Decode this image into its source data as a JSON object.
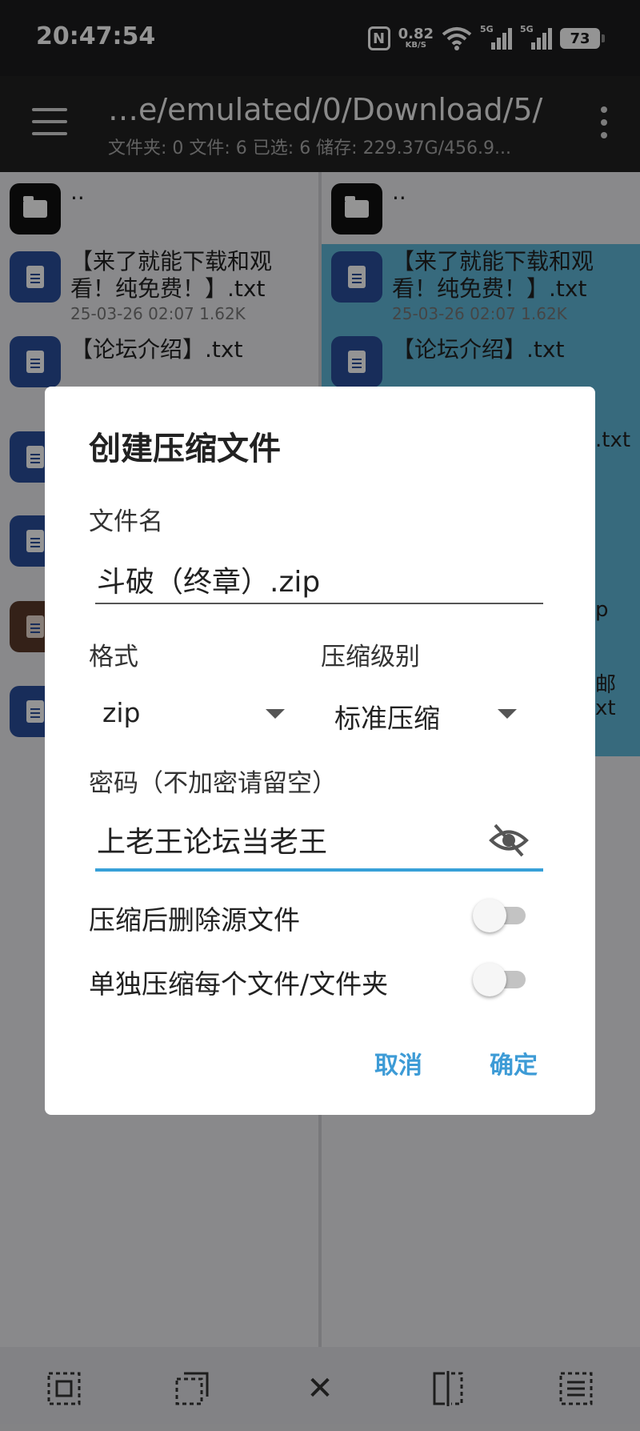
{
  "status_bar": {
    "time": "20:47:54",
    "nfc": "N",
    "net_speed": "0.82",
    "net_unit": "KB/S",
    "sim1_label": "5G",
    "sim2_label": "5G",
    "battery": "73"
  },
  "toolbar": {
    "path": "…e/emulated/0/Download/5/",
    "summary": "文件夹: 0  文件: 6  已选: 6  储存: 229.37G/456.9..."
  },
  "left_pane": {
    "parent": "..",
    "file1_name": "【来了就能下载和观看！纯免费！】.txt",
    "file1_meta": "25-03-26 02:07  1.62K",
    "file2_name": "【论坛介绍】.txt"
  },
  "right_pane": {
    "parent": "..",
    "file1_name": "【来了就能下载和观看！纯免费！】.txt",
    "file1_meta": "25-03-26 02:07  1.62K",
    "file2_name": "【论坛介绍】.txt",
    "frag_txt": ".txt",
    "frag_p": "p",
    "frag_you": "邮",
    "frag_xt": "xt"
  },
  "dialog": {
    "title": "创建压缩文件",
    "filename_label": "文件名",
    "filename_value": "斗破（终章）.zip",
    "format_label": "格式",
    "format_value": "zip",
    "level_label": "压缩级别",
    "level_value": "标准压缩",
    "password_label": "密码（不加密请留空）",
    "password_value": "上老王论坛当老王",
    "delete_source_label": "压缩后删除源文件",
    "separate_label": "单独压缩每个文件/文件夹",
    "cancel": "取消",
    "ok": "确定"
  },
  "bottom_bar": {
    "close_glyph": "✕"
  }
}
